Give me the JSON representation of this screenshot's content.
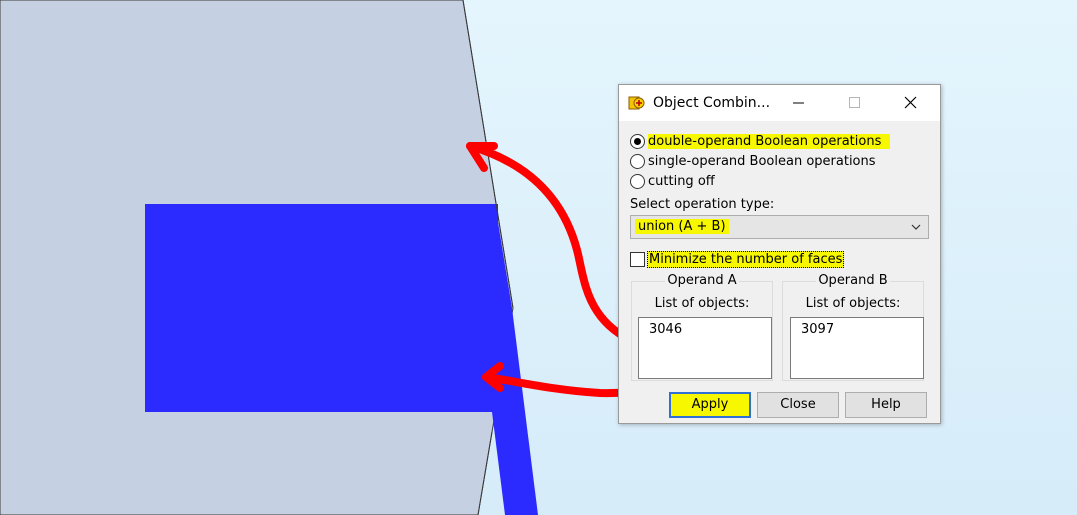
{
  "dialog": {
    "title": "Object Combin...",
    "modes": [
      {
        "label": "double-operand Boolean operations",
        "selected": true
      },
      {
        "label": "single-operand Boolean operations",
        "selected": false
      },
      {
        "label": "cutting off",
        "selected": false
      }
    ],
    "operation_type_label": "Select operation type:",
    "operation_type_value": "union (A + B)",
    "minimize_faces_label": "Minimize the number of faces",
    "minimize_faces_checked": false,
    "operand_a": {
      "title": "Operand A",
      "list_label": "List of objects:",
      "items": [
        "3046"
      ]
    },
    "operand_b": {
      "title": "Operand B",
      "list_label": "List of objects:",
      "items": [
        "3097"
      ]
    },
    "buttons": {
      "apply": "Apply",
      "close": "Close",
      "help": "Help"
    }
  },
  "colors": {
    "viewport_background": "#dff2fc",
    "object_gray": "#c6d0e3",
    "object_blue": "#2b2bff",
    "highlight": "#f7f700",
    "annotation_arrow": "#ff0000"
  },
  "icons": {
    "app": "object-combine-icon",
    "minimize": "minimize-icon",
    "maximize": "maximize-icon",
    "close": "close-icon",
    "dropdown": "chevron-down-icon"
  }
}
